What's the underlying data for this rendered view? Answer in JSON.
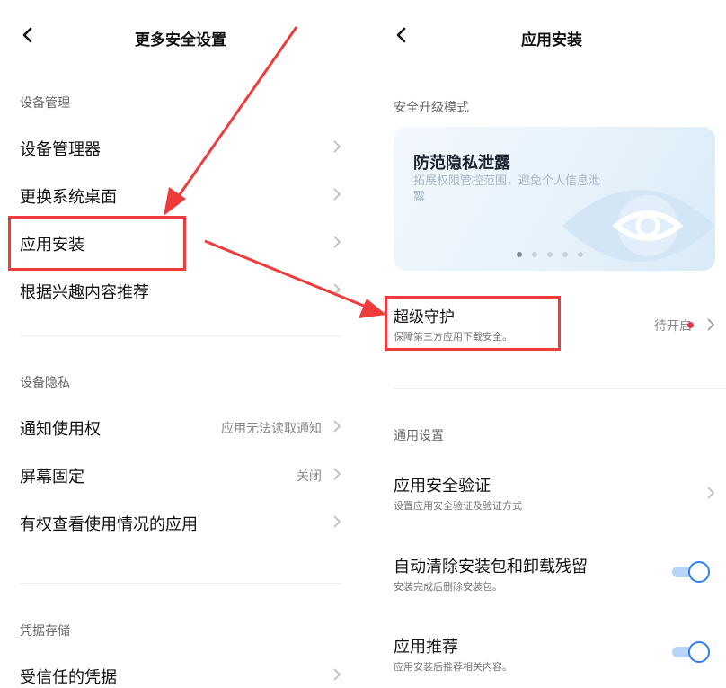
{
  "left": {
    "title": "更多安全设置",
    "sections": [
      {
        "header": "设备管理",
        "items": [
          {
            "label": "设备管理器",
            "value": ""
          },
          {
            "label": "更换系统桌面",
            "value": ""
          },
          {
            "label": "应用安装",
            "value": ""
          },
          {
            "label": "根据兴趣内容推荐",
            "value": ""
          }
        ]
      },
      {
        "header": "设备隐私",
        "items": [
          {
            "label": "通知使用权",
            "value": "应用无法读取通知"
          },
          {
            "label": "屏幕固定",
            "value": "关闭"
          },
          {
            "label": "有权查看使用情况的应用",
            "value": ""
          }
        ]
      },
      {
        "header": "凭据存储",
        "items": [
          {
            "label": "受信任的凭据",
            "value": ""
          }
        ]
      }
    ]
  },
  "right": {
    "title": "应用安装",
    "banner_section": "安全升级模式",
    "banner": {
      "title": "防范隐私泄露",
      "desc": "拓展权限管控范围，避免个人信息泄露",
      "pages": 5,
      "active_page": 1
    },
    "super_guard": {
      "label": "超级守护",
      "sub": "保障第三方应用下载安全。",
      "status": "待开启"
    },
    "general_section": "通用设置",
    "verify": {
      "label": "应用安全验证",
      "sub": "设置应用安全验证及验证方式"
    },
    "auto_clean": {
      "label": "自动清除安装包和卸载残留",
      "sub": "安装完成后删除安装包。",
      "enabled": true
    },
    "recommend": {
      "label": "应用推荐",
      "sub": "应用安装后推荐相关内容。",
      "enabled": true
    }
  },
  "colors": {
    "accent": "#2f7ef5",
    "highlight": "#ee3b3b",
    "status_dot": "#e53946"
  }
}
